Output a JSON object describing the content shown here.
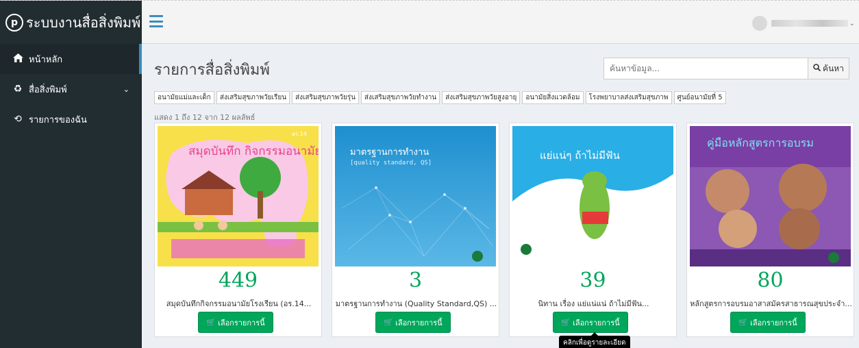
{
  "brand": {
    "logo": "p",
    "name": "ระบบงานสื่อสิ่งพิมพ์"
  },
  "sidebar": {
    "items": [
      {
        "label": "หน้าหลัก",
        "icon": "home-icon"
      },
      {
        "label": "สื่อสิ่งพิมพ์",
        "icon": "recycle-icon"
      },
      {
        "label": "รายการของฉัน",
        "icon": "history-icon"
      }
    ]
  },
  "main": {
    "title": "รายการสื่อสิ่งพิมพ์",
    "search": {
      "placeholder": "ค้นหาข้อมูล...",
      "button": "ค้นหา"
    },
    "filters": [
      "อนามัยแม่และเด็ก",
      "ส่งเสริมสุขภาพวัยเรียน",
      "ส่งเสริมสุขภาพวัยรุ่น",
      "ส่งเสริมสุขภาพวัยทำงาน",
      "ส่งเสริมสุขภาพวัยสูงอายุ",
      "อนามัยสิ่งแวดล้อม",
      "โรงพยาบาลส่งเสริมสุขภาพ",
      "ศูนย์อนามัยที่ 5"
    ],
    "result_info": "แสดง 1 ถึง 12 จาก 12 ผลลัพธ์",
    "cards": [
      {
        "count": "449",
        "title": "สมุดบันทึกกิจกรรมอนามัยโรงเรียน (อร.14...",
        "button": "เลือกรายการนี้",
        "cover_title": "สมุดบันทึก กิจกรรมอนามัยโรงเรียน",
        "cover_tag": "อร.14"
      },
      {
        "count": "3",
        "title": "มาตรฐานการทำงาน (Quality Standard,QS) ...",
        "button": "เลือกรายการนี้",
        "cover_title": "มาตรฐานการทำงาน",
        "cover_sub": "[quality standard, QS]"
      },
      {
        "count": "39",
        "title": "นิทาน เรื่อง แย่แน่แน่ ถ้าไม่มีฟัน...",
        "button": "เลือกรายการนี้",
        "cover_title": "แย่แน่ๆ ถ้าไม่มีฟัน"
      },
      {
        "count": "80",
        "title": "หลักสูตรการอบรมอาสาสมัครสาธารณสุขประจำ...",
        "button": "เลือกรายการนี้",
        "cover_title": "คู่มือหลักสูตรการอบรม"
      }
    ],
    "tooltip": "คลิกเพื่อดูรายละเอียด"
  },
  "colors": {
    "sidebar": "#222d32",
    "accent": "#3c8dbc",
    "button": "#00a65a",
    "count": "#00a65a"
  }
}
